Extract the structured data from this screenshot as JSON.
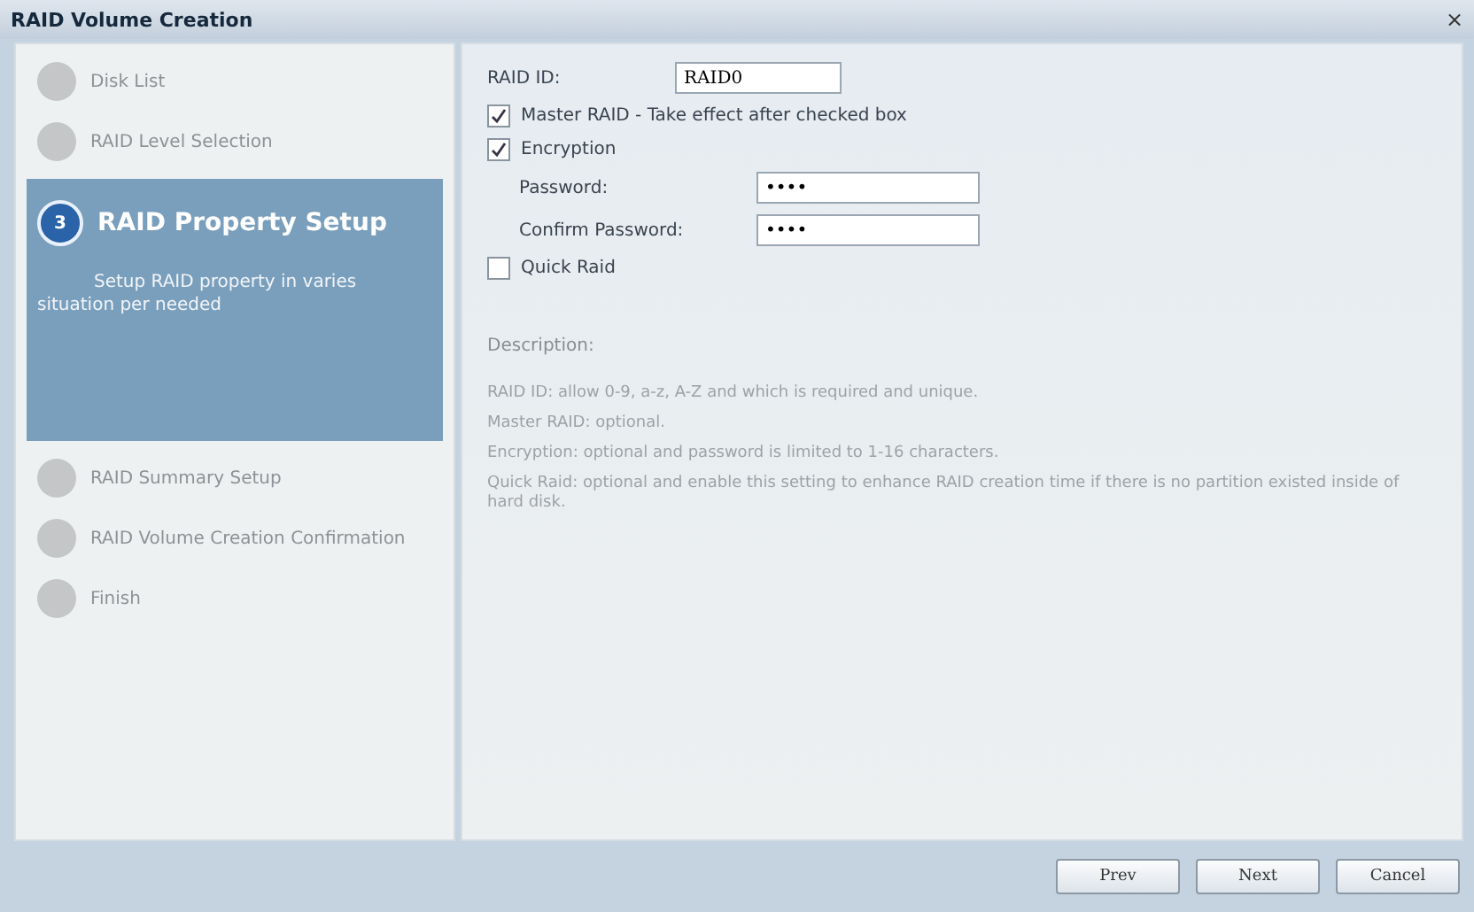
{
  "window": {
    "title": "RAID Volume Creation",
    "close": "×"
  },
  "steps": [
    {
      "label": "Disk List",
      "selected": false
    },
    {
      "label": "RAID Level Selection",
      "selected": false
    },
    {
      "label": "RAID Property Setup",
      "number": "3",
      "description": "Setup RAID property in varies situation per needed",
      "selected": true
    },
    {
      "label": "RAID Summary Setup",
      "selected": false
    },
    {
      "label": "RAID Volume Creation Confirmation",
      "selected": false
    },
    {
      "label": "Finish",
      "selected": false
    }
  ],
  "form": {
    "raid_id": {
      "label": "RAID ID:",
      "value": "RAID0"
    },
    "master_raid": {
      "label": "Master RAID - Take effect after checked box",
      "checked": true
    },
    "encryption": {
      "label": "Encryption",
      "checked": true
    },
    "password": {
      "label": "Password:",
      "value": "••••"
    },
    "confirm_password": {
      "label": "Confirm Password:",
      "value": "••••"
    },
    "quick_raid": {
      "label": "Quick Raid",
      "checked": false
    }
  },
  "description": {
    "title": "Description:",
    "lines": [
      "RAID ID: allow 0-9, a-z, A-Z and which is required and unique.",
      "Master RAID: optional.",
      "Encryption: optional and password is limited to 1-16 characters.",
      "Quick Raid: optional and enable this setting to enhance RAID creation time if there is no partition existed inside of hard disk."
    ]
  },
  "buttons": [
    "Prev",
    "Next",
    "Cancel"
  ]
}
